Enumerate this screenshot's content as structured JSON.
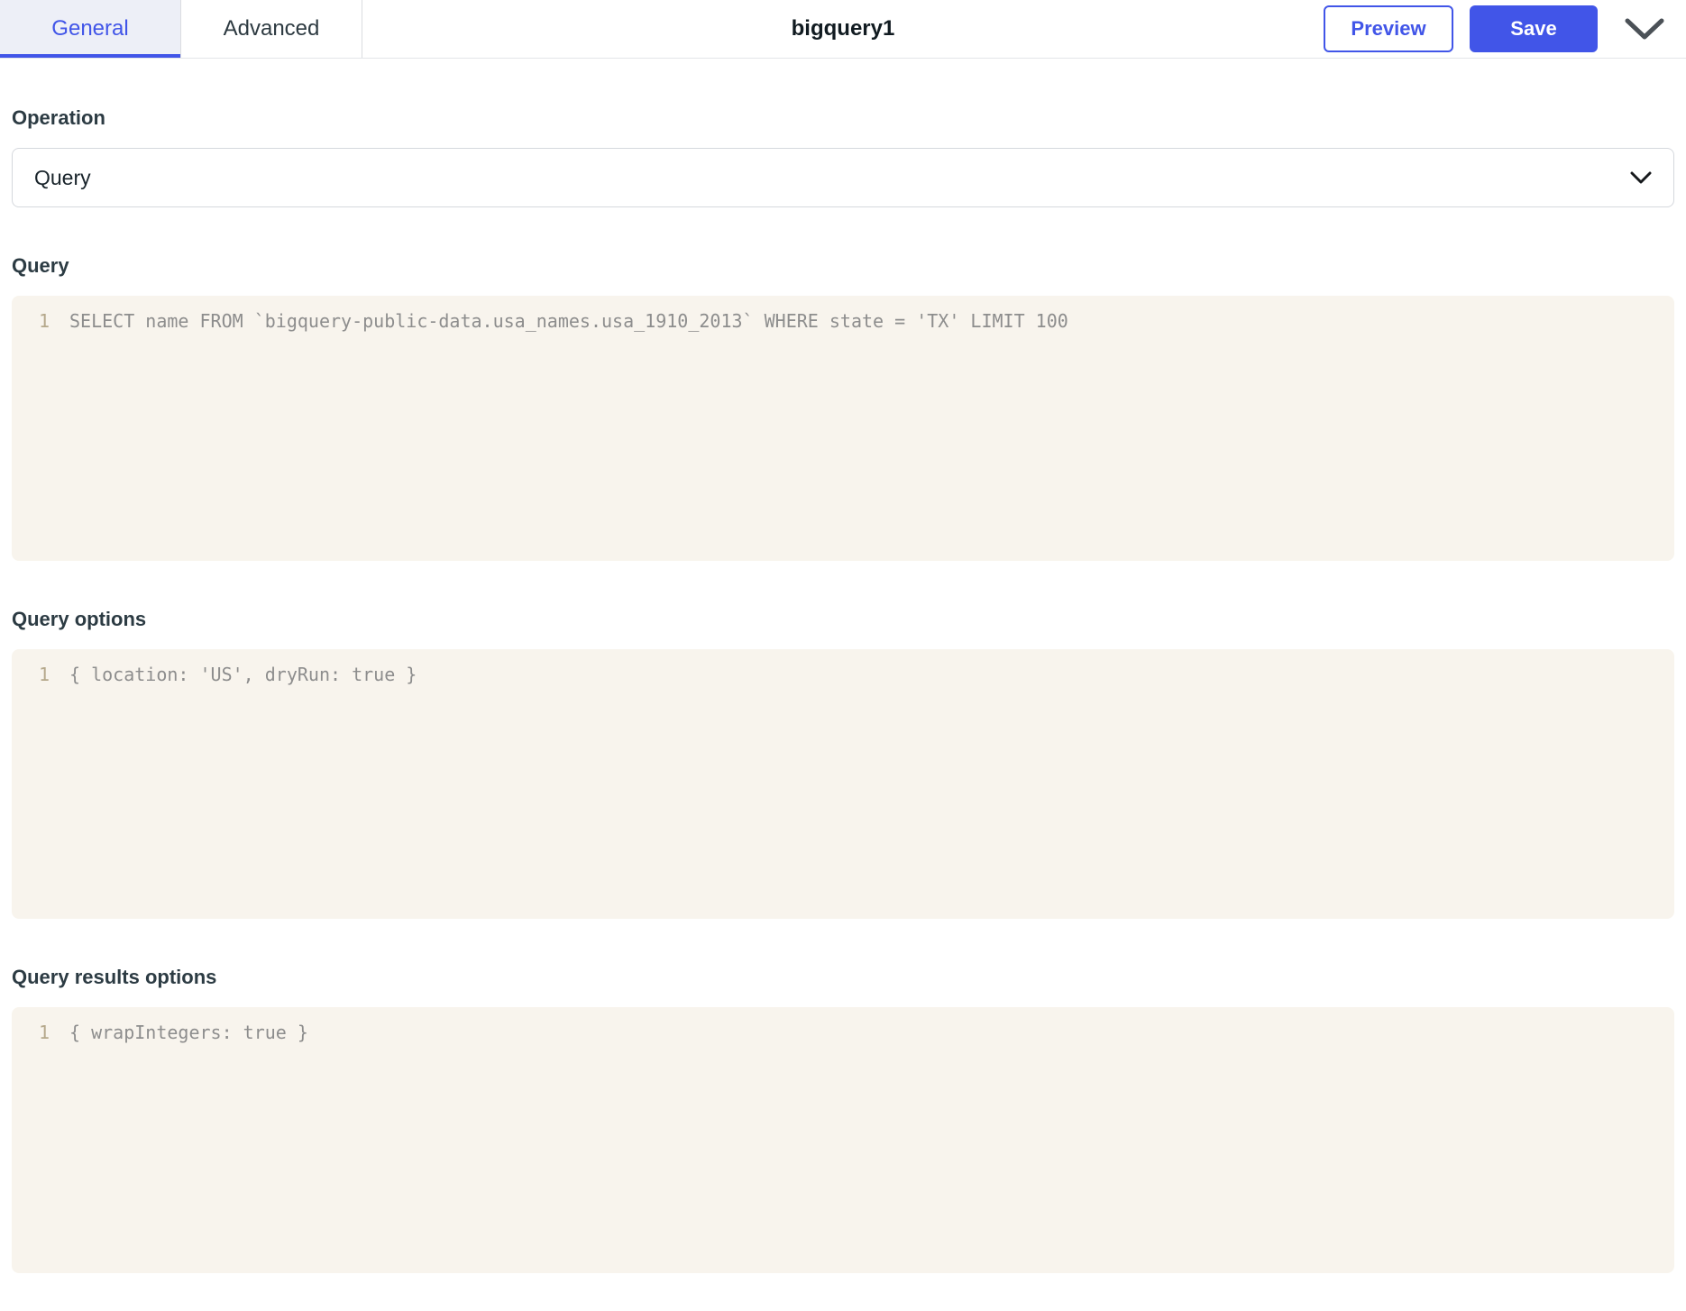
{
  "tabs": [
    {
      "label": "General",
      "active": true
    },
    {
      "label": "Advanced",
      "active": false
    }
  ],
  "header": {
    "title": "bigquery1",
    "preview_label": "Preview",
    "save_label": "Save",
    "more_icon": "chevron-down-icon"
  },
  "operation": {
    "label": "Operation",
    "selected_value": "Query",
    "chevron_icon": "chevron-down-icon"
  },
  "query": {
    "label": "Query",
    "line_number": "1",
    "code": "SELECT name FROM `bigquery-public-data.usa_names.usa_1910_2013` WHERE state = 'TX' LIMIT 100"
  },
  "query_options": {
    "label": "Query options",
    "line_number": "1",
    "code": "{ location: 'US', dryRun: true }"
  },
  "query_results_options": {
    "label": "Query results options",
    "line_number": "1",
    "code": "{ wrapIntegers: true }"
  },
  "colors": {
    "accent": "#4155e8",
    "tab-active-bg": "#edeff7",
    "editor-bg": "#f8f4ed",
    "code-text": "#8d8d8d",
    "line-number": "#b5a88b",
    "label": "#2c3b43"
  }
}
